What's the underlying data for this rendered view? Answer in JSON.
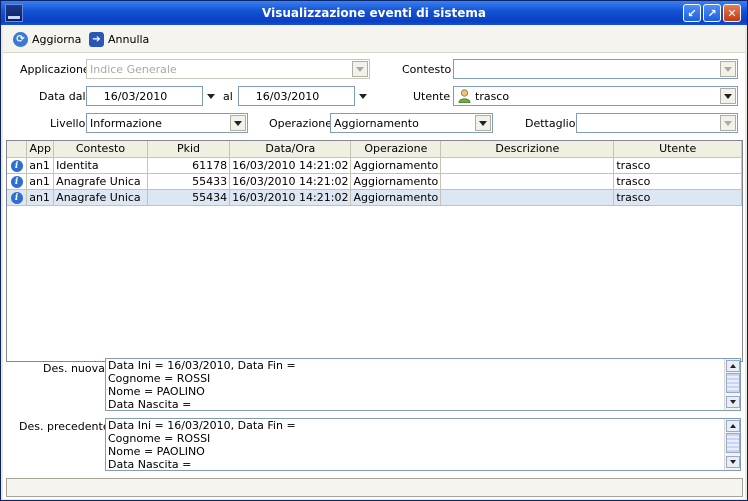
{
  "window": {
    "title": "Visualizzazione eventi di sistema",
    "controls": {
      "restore": "↙",
      "maximize": "↗",
      "close": "✕"
    }
  },
  "toolbar": {
    "refresh_label": "Aggiorna",
    "refresh_icon": "refresh-icon",
    "cancel_label": "Annulla",
    "cancel_icon": "arrow-right-icon"
  },
  "filters": {
    "applicazione_label": "Applicazione",
    "applicazione_value": "Indice Generale",
    "contesto_label": "Contesto",
    "contesto_value": "",
    "data_dal_label": "Data dal",
    "data_dal_value": "16/03/2010",
    "al_label": "al",
    "data_al_value": "16/03/2010",
    "utente_label": "Utente",
    "utente_value": "trasco",
    "utente_icon": "user-icon",
    "livello_label": "Livello",
    "livello_value": "Informazione",
    "operazione_label": "Operazione",
    "operazione_value": "Aggiornamento",
    "dettaglio_label": "Dettaglio",
    "dettaglio_value": ""
  },
  "grid": {
    "columns": [
      "",
      "App",
      "Contesto",
      "Pkid",
      "Data/Ora",
      "Operazione",
      "Descrizione",
      "Utente"
    ],
    "row_icon": "info-icon",
    "rows": [
      {
        "app": "an1",
        "contesto": "Identita",
        "pkid": "61178",
        "dataora": "16/03/2010 14:21:02",
        "operazione": "Aggiornamento",
        "descrizione": "",
        "utente": "trasco"
      },
      {
        "app": "an1",
        "contesto": "Anagrafe Unica",
        "pkid": "55433",
        "dataora": "16/03/2010 14:21:02",
        "operazione": "Aggiornamento",
        "descrizione": "",
        "utente": "trasco"
      },
      {
        "app": "an1",
        "contesto": "Anagrafe Unica",
        "pkid": "55434",
        "dataora": "16/03/2010 14:21:02",
        "operazione": "Aggiornamento",
        "descrizione": "",
        "utente": "trasco"
      }
    ],
    "selected_row": 2
  },
  "details": {
    "nuova_label": "Des. nuova",
    "nuova_lines": [
      "Data Ini = 16/03/2010, Data Fin =",
      "Cognome = ROSSI",
      "Nome = PAOLINO",
      "Data Nascita ="
    ],
    "precedente_label": "Des. precedente",
    "precedente_lines": [
      "Data Ini = 16/03/2010, Data Fin =",
      "Cognome = ROSSI",
      "Nome = PAOLINO",
      "Data Nascita ="
    ]
  },
  "colors": {
    "titlebar": "#0a3fc4",
    "selection": "#dde7f3",
    "info_icon": "#2f6fd0"
  }
}
